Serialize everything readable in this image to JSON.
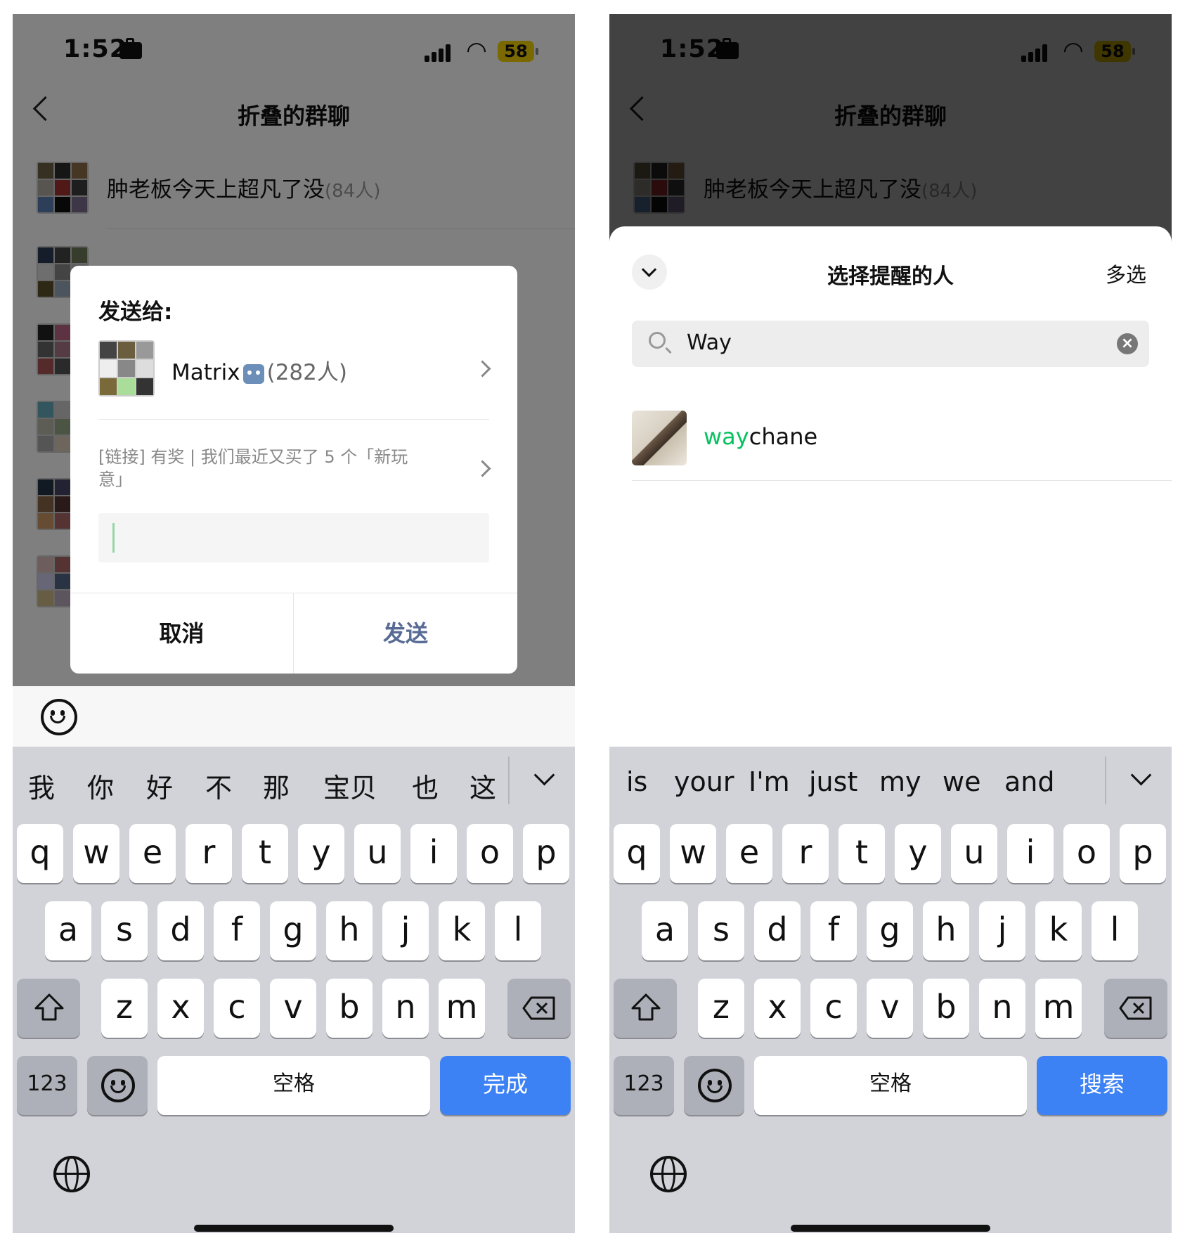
{
  "status": {
    "time": "1:52",
    "battery": "58"
  },
  "nav": {
    "title": "折叠的群聊"
  },
  "chat_list": {
    "first_group_name": "肿老板今天上超凡了没",
    "first_group_count": "(84人)"
  },
  "send_dialog": {
    "title": "发送给:",
    "target_name": "Matrix",
    "target_count": "(282人)",
    "message_preview": "[链接] 有奖 | 我们最近又买了 5 个「新玩意」",
    "cancel_label": "取消",
    "send_label": "发送"
  },
  "mention_sheet": {
    "title": "选择提醒的人",
    "multi_select_label": "多选",
    "search_value": "Way",
    "result_name_match": "way",
    "result_name_rest": "chane"
  },
  "keyboard_left": {
    "candidates": [
      "我",
      "你",
      "好",
      "不",
      "那",
      "宝贝",
      "也",
      "这"
    ],
    "space_label": "空格",
    "action_label": "完成",
    "numbers_label": "123"
  },
  "keyboard_right": {
    "candidates": [
      "is",
      "your",
      "I'm",
      "just",
      "my",
      "we",
      "and"
    ],
    "space_label": "空格",
    "action_label": "搜索",
    "numbers_label": "123"
  },
  "keys": {
    "row1": [
      "q",
      "w",
      "e",
      "r",
      "t",
      "y",
      "u",
      "i",
      "o",
      "p"
    ],
    "row2": [
      "a",
      "s",
      "d",
      "f",
      "g",
      "h",
      "j",
      "k",
      "l"
    ],
    "row3": [
      "z",
      "x",
      "c",
      "v",
      "b",
      "n",
      "m"
    ]
  },
  "colors": {
    "accent_green": "#07c160",
    "key_blue": "#3d82f5",
    "link_blue": "#576b95"
  },
  "icons": [
    "back-chevron-icon",
    "briefcase-icon",
    "signal-icon",
    "wifi-icon",
    "search-icon",
    "clear-icon",
    "smile-icon",
    "shift-icon",
    "backspace-icon",
    "globe-icon",
    "robot-icon",
    "collapse-chevron-icon"
  ]
}
